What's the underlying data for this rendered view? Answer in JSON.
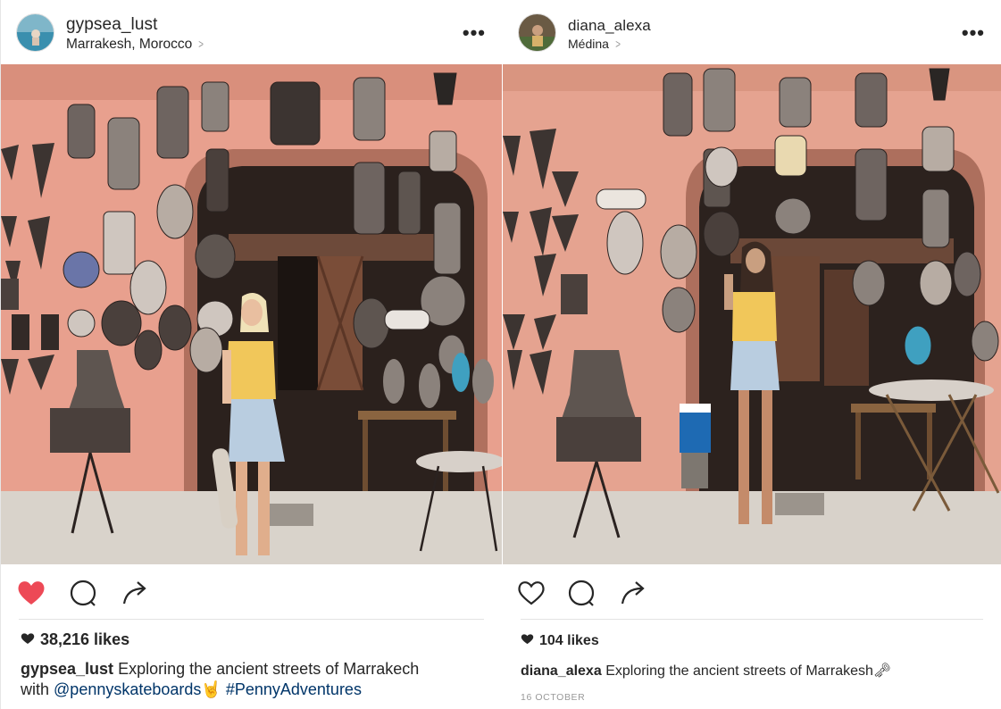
{
  "posts": [
    {
      "username": "gypsea_lust",
      "location": "Marrakesh, Morocco",
      "more_label": "•••",
      "liked": true,
      "likes": "38,216 likes",
      "caption_user": "gypsea_lust",
      "caption_text_1": "Exploring the ancient streets of Marrakech",
      "caption_text_2": "with",
      "mention": "@pennyskateboards",
      "emoji": "🤘",
      "hashtag": "#PennyAdventures"
    },
    {
      "username": "diana_alexa",
      "location": "Médina",
      "more_label": "•••",
      "liked": false,
      "likes": "104 likes",
      "caption_user": "diana_alexa",
      "caption_text_1": "Exploring the ancient streets of Marrakesh",
      "emoji": "🗝",
      "date": "16 OCTOBER"
    }
  ],
  "colors": {
    "like_red": "#ed4956",
    "link_blue": "#003569",
    "wall_pink": "#e69f8c",
    "text": "#262626"
  },
  "icons": [
    "heart-icon",
    "comment-icon",
    "share-icon",
    "more-icon",
    "chevron-right-icon"
  ]
}
